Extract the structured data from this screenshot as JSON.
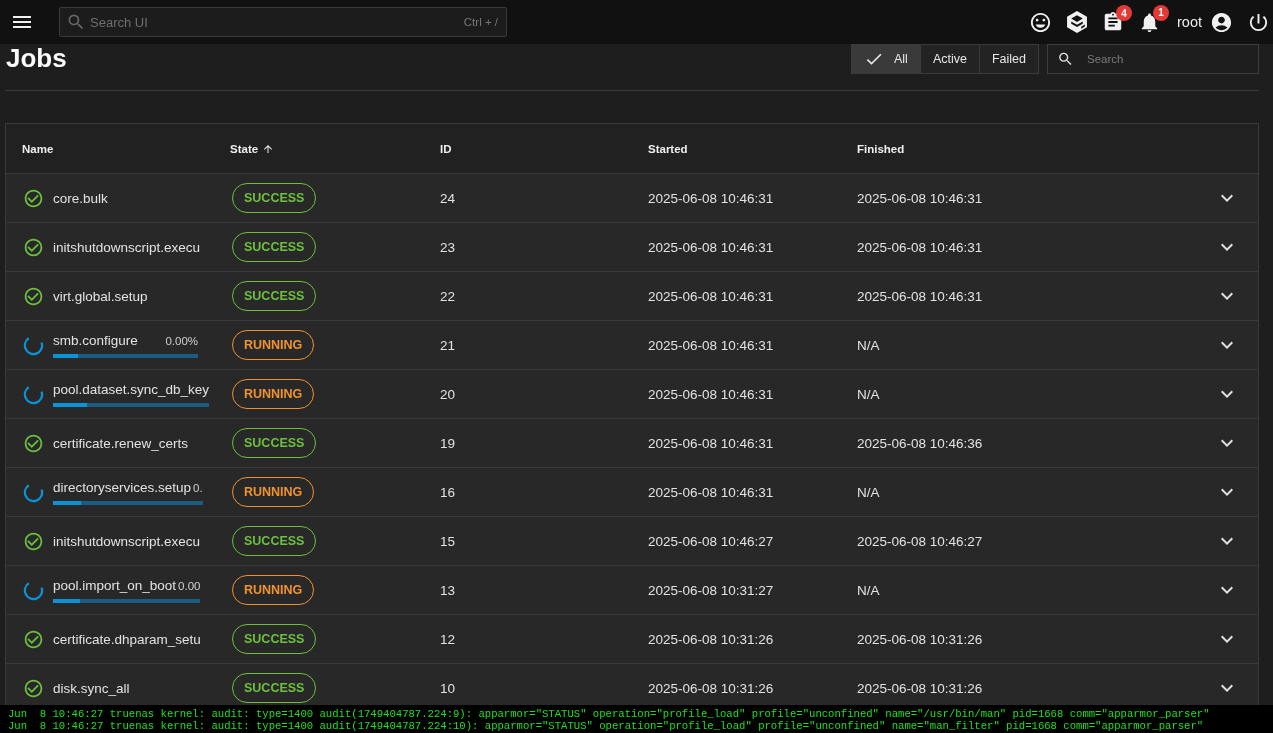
{
  "top_bar": {
    "search": {
      "placeholder": "Search UI",
      "shortcut": "Ctrl + /"
    },
    "task_count": "4",
    "alert_count": "1",
    "username": "root"
  },
  "page": {
    "title": "Jobs"
  },
  "filters": [
    {
      "label": "All",
      "selected": true
    },
    {
      "label": "Active",
      "selected": false
    },
    {
      "label": "Failed",
      "selected": false
    }
  ],
  "search": {
    "placeholder": "Search"
  },
  "table": {
    "columns": [
      {
        "label": "Name",
        "sorted": false
      },
      {
        "label": "State",
        "sorted": true
      },
      {
        "label": "ID",
        "sorted": false
      },
      {
        "label": "Started",
        "sorted": false
      },
      {
        "label": "Finished",
        "sorted": false
      }
    ],
    "rows": [
      {
        "kind": "success",
        "name": "core.bulk",
        "state": "SUCCESS",
        "id": "24",
        "started": "2025-06-08 10:46:31",
        "finished": "2025-06-08 10:46:31",
        "expanded": false
      },
      {
        "kind": "success",
        "name": "initshutdownscript.execu",
        "state": "SUCCESS",
        "id": "23",
        "started": "2025-06-08 10:46:31",
        "finished": "2025-06-08 10:46:31",
        "expanded": false
      },
      {
        "kind": "success",
        "name": "virt.global.setup",
        "state": "SUCCESS",
        "id": "22",
        "started": "2025-06-08 10:46:31",
        "finished": "2025-06-08 10:46:31",
        "expanded": false
      },
      {
        "kind": "running",
        "name": "smb.configure",
        "progress_text": "0.00%",
        "level": 0.17,
        "state": "RUNNING",
        "id": "21",
        "started": "2025-06-08 10:46:31",
        "finished": "N/A",
        "expanded": false
      },
      {
        "kind": "running",
        "name": "pool.dataset.sync_db_key",
        "level": 0.22,
        "state": "RUNNING",
        "id": "20",
        "started": "2025-06-08 10:46:31",
        "finished": "N/A",
        "expanded": false
      },
      {
        "kind": "success",
        "name": "certificate.renew_certs",
        "state": "SUCCESS",
        "id": "19",
        "started": "2025-06-08 10:46:31",
        "finished": "2025-06-08 10:46:36",
        "expanded": false
      },
      {
        "kind": "running",
        "name": "directoryservices.setup",
        "progress_text": "0.",
        "level": 0.19,
        "state": "RUNNING",
        "id": "16",
        "started": "2025-06-08 10:46:31",
        "finished": "N/A",
        "expanded": false
      },
      {
        "kind": "success",
        "name": "initshutdownscript.execu",
        "state": "SUCCESS",
        "id": "15",
        "started": "2025-06-08 10:46:27",
        "finished": "2025-06-08 10:46:27",
        "expanded": false
      },
      {
        "kind": "running",
        "name": "pool.import_on_boot",
        "progress_text": "0.00",
        "level": 0.18,
        "state": "RUNNING",
        "id": "13",
        "started": "2025-06-08 10:31:27",
        "finished": "N/A",
        "expanded": false
      },
      {
        "kind": "success",
        "name": "certificate.dhparam_setu",
        "state": "SUCCESS",
        "id": "12",
        "started": "2025-06-08 10:31:26",
        "finished": "2025-06-08 10:31:26",
        "expanded": false
      },
      {
        "kind": "success",
        "name": "disk.sync_all",
        "state": "SUCCESS",
        "id": "10",
        "started": "2025-06-08 10:31:26",
        "finished": "2025-06-08 10:31:26",
        "expanded": false
      }
    ]
  },
  "console": {
    "lines": [
      "Jun  8 10:46:27 truenas kernel: audit: type=1400 audit(1749404787.224:9): apparmor=\"STATUS\" operation=\"profile_load\" profile=\"unconfined\" name=\"/usr/bin/man\" pid=1668 comm=\"apparmor_parser\"",
      "Jun  8 10:46:27 truenas kernel: audit: type=1400 audit(1749404787.224:10): apparmor=\"STATUS\" operation=\"profile_load\" profile=\"unconfined\" name=\"man_filter\" pid=1668 comm=\"apparmor_parser\""
    ]
  }
}
